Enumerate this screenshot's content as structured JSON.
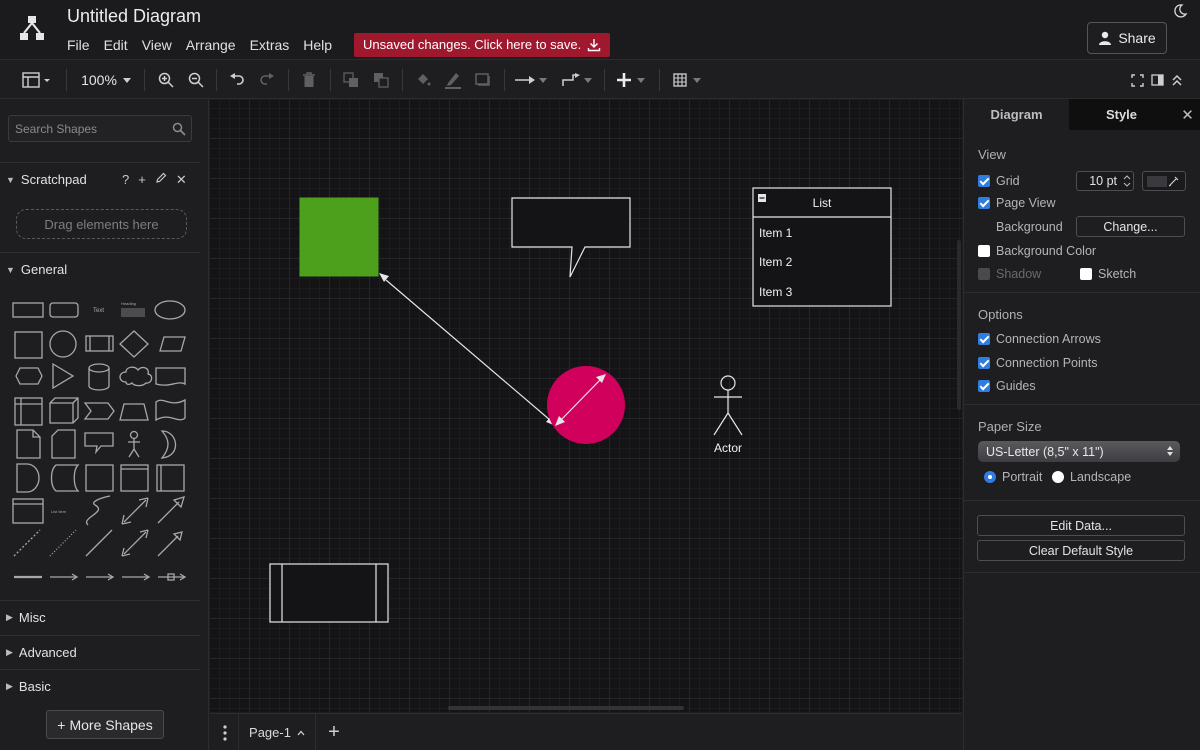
{
  "header": {
    "title": "Untitled Diagram",
    "menu": [
      "File",
      "Edit",
      "View",
      "Arrange",
      "Extras",
      "Help"
    ],
    "save_banner": "Unsaved changes. Click here to save.",
    "share_label": "Share"
  },
  "toolbar": {
    "zoom": "100%"
  },
  "sidebar": {
    "search_placeholder": "Search Shapes",
    "scratchpad": {
      "title": "Scratchpad",
      "help": "?",
      "drag_hint": "Drag elements here"
    },
    "sections": [
      "General",
      "Misc",
      "Advanced",
      "Basic"
    ],
    "shape_labels": {
      "text": "Text",
      "heading": "Heading",
      "list_item": "List Item"
    },
    "more_shapes": "More Shapes"
  },
  "canvas": {
    "list": {
      "title": "List",
      "items": [
        "Item 1",
        "Item 2",
        "Item 3"
      ]
    },
    "actor_label": "Actor",
    "colors": {
      "square": "#4da01c",
      "circle": "#d1005d",
      "stroke": "#e6e6e6"
    }
  },
  "pagebar": {
    "page_name": "Page-1"
  },
  "panel": {
    "tabs": [
      "Diagram",
      "Style"
    ],
    "view_heading": "View",
    "grid_label": "Grid",
    "grid_size": "10 pt",
    "page_view_label": "Page View",
    "background_label": "Background",
    "change_button": "Change...",
    "background_color_label": "Background Color",
    "shadow_label": "Shadow",
    "sketch_label": "Sketch",
    "options_heading": "Options",
    "connection_arrows": "Connection Arrows",
    "connection_points": "Connection Points",
    "guides": "Guides",
    "paper_size_heading": "Paper Size",
    "paper_size": "US-Letter (8,5\" x 11\")",
    "portrait": "Portrait",
    "landscape": "Landscape",
    "edit_data": "Edit Data...",
    "clear_default_style": "Clear Default Style"
  }
}
